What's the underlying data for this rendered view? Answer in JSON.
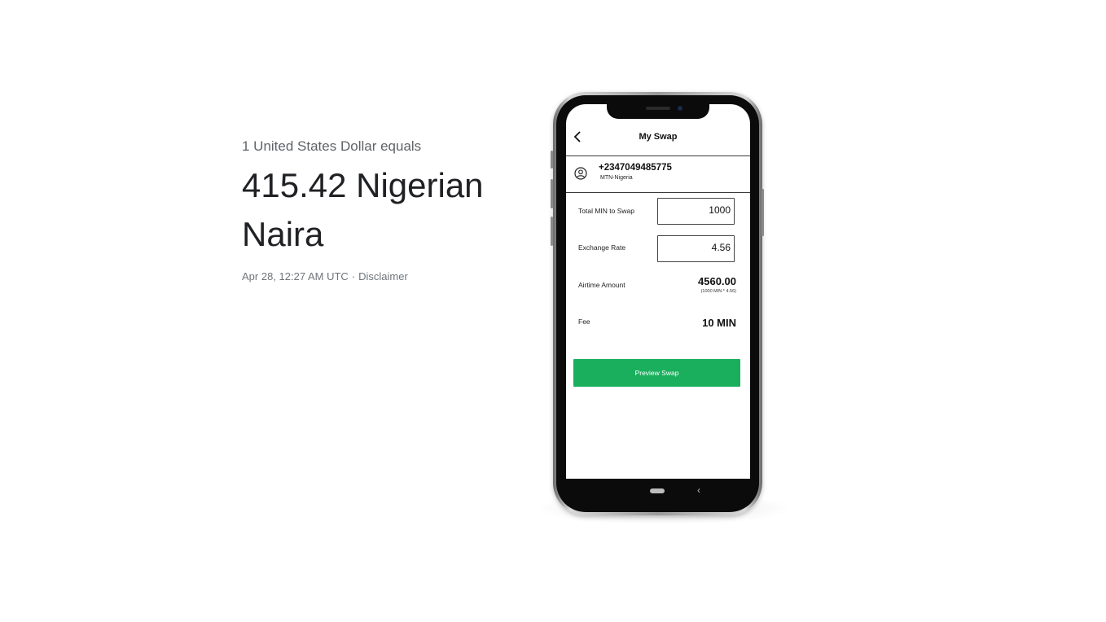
{
  "conversion": {
    "intro": "1 United States Dollar equals",
    "result_line1": "415.42 Nigerian",
    "result_line2": "Naira",
    "timestamp": "Apr 28, 12:27 AM UTC",
    "separator": "·",
    "disclaimer": "Disclaimer"
  },
  "app": {
    "header": {
      "back_icon": "chevron-left-icon",
      "title": "My Swap"
    },
    "account": {
      "icon": "user-circle-icon",
      "number": "+2347049485775",
      "network": "MTN-Nigeria"
    },
    "total_min": {
      "label": "Total MIN to Swap",
      "value": "1000"
    },
    "exchange_rate": {
      "label": "Exchange Rate",
      "value": "4.56"
    },
    "airtime": {
      "label": "Airtime Amount",
      "value": "4560.00",
      "note": "(1000 MIN * 4.56)"
    },
    "fee": {
      "label": "Fee",
      "value": "10 MIN"
    },
    "preview_button": "Preview Swap",
    "accent_color": "#1aaf5d"
  },
  "android_nav": {
    "home_icon": "home-pill-icon",
    "back_icon": "nav-back-icon",
    "back_glyph": "‹"
  }
}
